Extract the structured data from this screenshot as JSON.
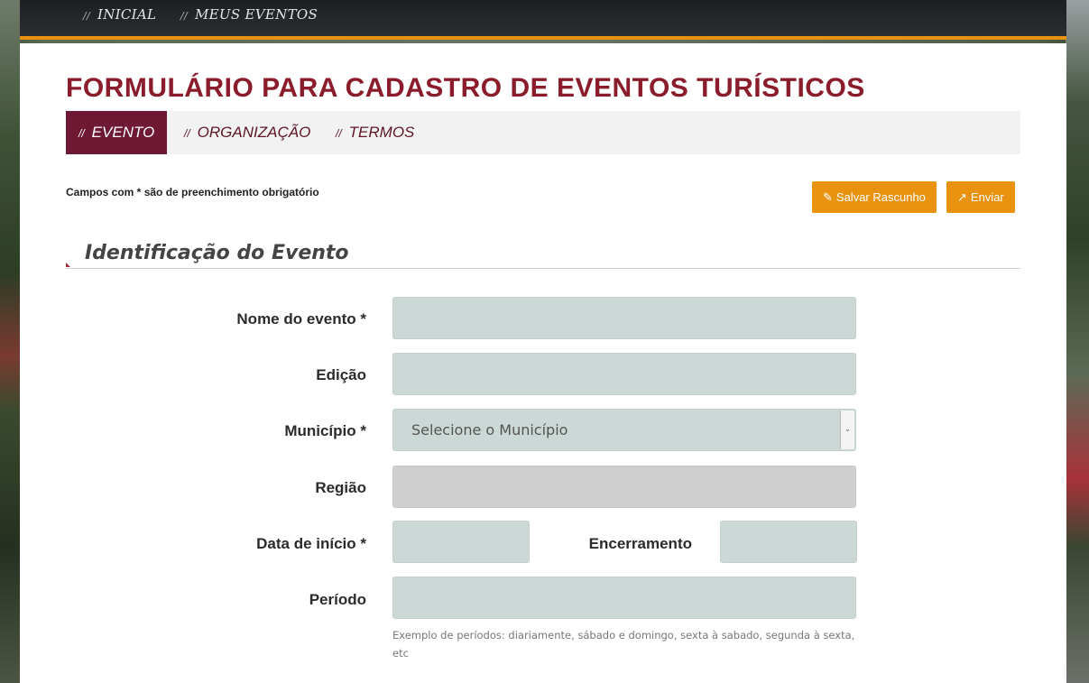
{
  "topnav": {
    "items": [
      {
        "label": "INICIAL"
      },
      {
        "label": "MEUS EVENTOS"
      }
    ],
    "separator": "//"
  },
  "page": {
    "title": "FORMULÁRIO PARA CADASTRO DE EVENTOS TURÍSTICOS"
  },
  "tabs": [
    {
      "label": "EVENTO",
      "active": true
    },
    {
      "label": "ORGANIZAÇÃO",
      "active": false
    },
    {
      "label": "TERMOS",
      "active": false
    }
  ],
  "required_note": "Campos com * são de preenchimento obrigatório",
  "actions": {
    "save_draft_label": "Salvar Rascunho",
    "submit_label": "Enviar",
    "save_draft_icon": "edit-icon",
    "submit_icon": "share-icon"
  },
  "section": {
    "title": "Identificação do Evento"
  },
  "form": {
    "event_name_label": "Nome do evento *",
    "edition_label": "Edição",
    "municipality_label": "Município *",
    "municipality_placeholder": "Selecione o Município",
    "region_label": "Região",
    "start_date_label": "Data de início *",
    "end_label": "Encerramento",
    "period_label": "Período",
    "period_help": "Exemplo de períodos: diariamente, sábado e domingo, sexta à sabado, segunda à sexta, etc"
  },
  "colors": {
    "accent": "#e8920f",
    "brand": "#8a1c2b",
    "active_tab": "#6e1833",
    "input_bg": "#cbd8d6"
  }
}
